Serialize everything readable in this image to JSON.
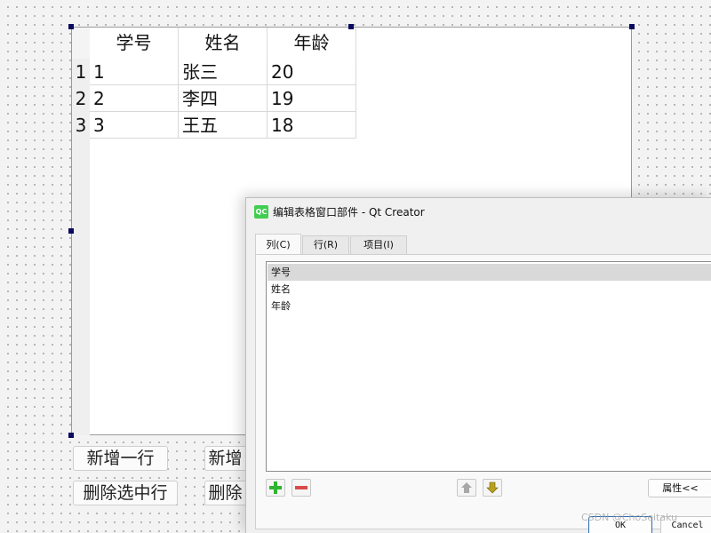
{
  "table_widget": {
    "columns": [
      "学号",
      "姓名",
      "年龄"
    ],
    "row_numbers": [
      "1",
      "2",
      "3"
    ],
    "rows": [
      [
        "1",
        "张三",
        "20"
      ],
      [
        "2",
        "李四",
        "19"
      ],
      [
        "3",
        "王五",
        "18"
      ]
    ]
  },
  "form_buttons": {
    "add_row": "新增一行",
    "add_partial": "新增",
    "delete_selected": "删除选中行",
    "delete_partial": "删除"
  },
  "dialog": {
    "title": "编辑表格窗口部件 - Qt Creator",
    "app_icon_text": "QC",
    "tabs": [
      "列(C)",
      "行(R)",
      "项目(I)"
    ],
    "active_tab": "列(C)",
    "list_items": [
      "学号",
      "姓名",
      "年龄"
    ],
    "selected_item": "学号",
    "properties_button": "属性<<",
    "ok_button": "OK",
    "cancel_button": "Cancel"
  },
  "watermark": "CSDN @ChoSeitaku",
  "colors": {
    "selection_handle": "#0a0a5e",
    "add_icon": "#2fb52f",
    "remove_icon": "#d94a4a",
    "move_down_icon": "#b8a21c",
    "qt_brand": "#41cd52",
    "ok_border": "#2b6cb0"
  },
  "icons": [
    "plus-icon",
    "minus-icon",
    "arrow-up-icon",
    "arrow-down-icon"
  ]
}
